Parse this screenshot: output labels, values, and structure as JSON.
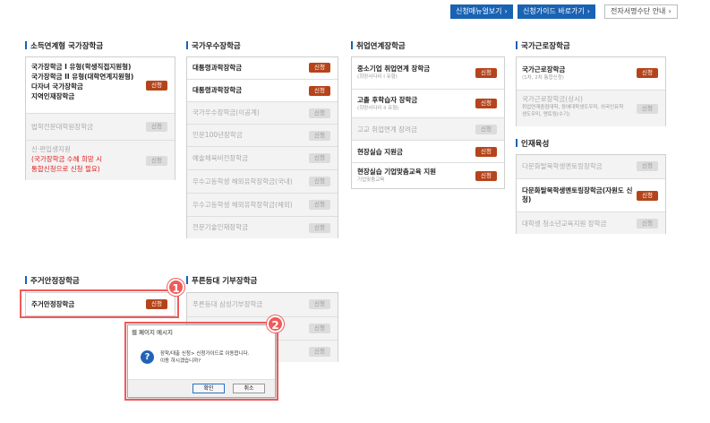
{
  "top_buttons": {
    "manual": "신청매뉴얼보기",
    "guide": "신청가이드 바로가기",
    "esign": "전자서명수단 안내"
  },
  "sections": {
    "income": {
      "title": "소득연계형 국가장학금",
      "main_lines": [
        "국가장학금 I 유형(학생직접지원형)",
        "국가장학금 II 유형(대학연계지원형)",
        "다자녀 국가장학금",
        "지역인재장학금"
      ],
      "law_label": "법학전문대학원장학금",
      "freshman_label": "신·편입생지원",
      "freshman_note": [
        "(국가장학금 수혜 희망 시",
        "통합신청으로 신청 필요)"
      ]
    },
    "excellence": {
      "title": "국가우수장학금",
      "items": [
        {
          "label": "대통령과학장학금",
          "active": true
        },
        {
          "label": "대통령과학장학금",
          "active": true
        },
        {
          "label": "국가우수장학금(이공계)",
          "active": false
        },
        {
          "label": "인문100년장학금",
          "active": false
        },
        {
          "label": "예술체육비전장학금",
          "active": false
        },
        {
          "label": "우수고등학생 해외유학장학금(국내)",
          "active": false
        },
        {
          "label": "우수고등학생 해외유학장학금(해외)",
          "active": false
        },
        {
          "label": "전문기술인재장학금",
          "active": false
        }
      ]
    },
    "employment": {
      "title": "취업연계장학금",
      "items": [
        {
          "label": "중소기업 취업연계 장학금",
          "sub": "(희망사다리 I 유형)",
          "active": true
        },
        {
          "label": "고졸 후학습자 장학금",
          "sub": "(희망사다리 II 유형)",
          "active": true
        },
        {
          "label": "고교 취업연계 장려금",
          "sub": "",
          "active": false
        },
        {
          "label": "현장실습 지원금",
          "sub": "",
          "active": true
        },
        {
          "label": "현장실습 기업맞춤교육 지원",
          "sub": "기업맞춤교육",
          "active": true
        }
      ]
    },
    "work": {
      "title": "국가근로장학금",
      "items": [
        {
          "label": "국가근로장학금",
          "sub": "(1차, 2차 통합신청)",
          "active": true
        },
        {
          "label": "국가근로장학금(상시)",
          "sub": "취업연계중점대학, 장애대학생도우미, 외국인유학생도우미, 멘토링(수기)",
          "active": false
        }
      ]
    },
    "talent": {
      "title": "인재육성",
      "items": [
        {
          "label": "다문화탈북학생멘토링장학금",
          "active": false
        },
        {
          "label": "다문화탈북학생멘토링장학금(자원도 신청)",
          "active": true
        },
        {
          "label": "대학생 청소년교육지원 장학금",
          "active": false
        }
      ]
    },
    "housing": {
      "title": "주거안정장학금",
      "items": [
        {
          "label": "주거안정장학금",
          "active": true
        }
      ]
    },
    "donation": {
      "title": "푸른등대 기부장학금",
      "items": [
        {
          "label": "푸른등대 삼성기부장학금",
          "active": false
        },
        {
          "label": "",
          "active": false
        },
        {
          "label": "",
          "active": false
        }
      ]
    }
  },
  "apply_label": "신청",
  "annotations": {
    "one": "1",
    "two": "2"
  },
  "dialog": {
    "title": "웹 페이지 메시지",
    "message_line1": "장학/대출 신청> 신청가이드로 이동합니다.",
    "message_line2": "이동 하시겠습니까?",
    "ok": "확인",
    "cancel": "취소"
  },
  "colors": {
    "accent": "#1a62b3",
    "apply": "#b5441b",
    "highlight": "#f05a5a"
  }
}
